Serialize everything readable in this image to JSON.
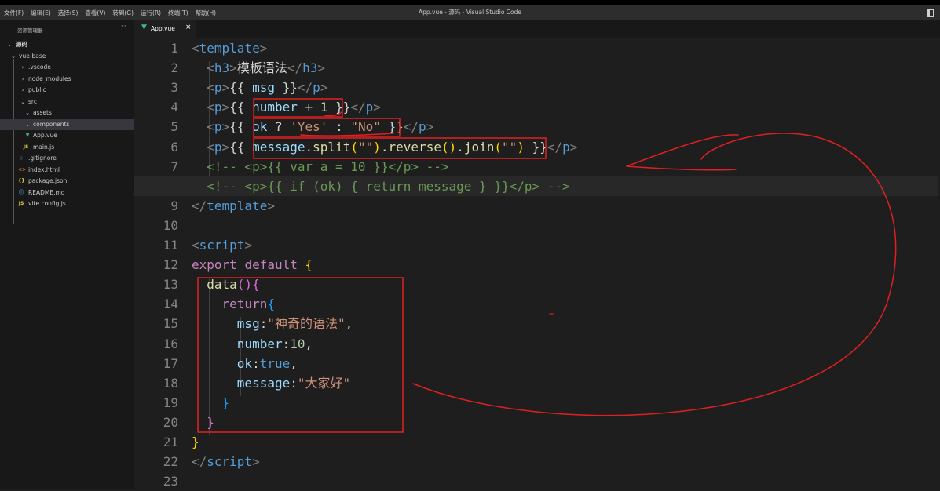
{
  "window": {
    "title": "App.vue - 源码 - Visual Studio Code"
  },
  "menu": [
    "文件(F)",
    "编辑(E)",
    "选择(S)",
    "查看(V)",
    "转到(G)",
    "运行(R)",
    "终端(T)",
    "帮助(H)"
  ],
  "sidebar": {
    "title": "资源管理器",
    "more": "···",
    "root": "源码",
    "project": "vue-base",
    "items": {
      "vscode": ".vscode",
      "node_modules": "node_modules",
      "public": "public",
      "src": "src",
      "assets": "assets",
      "components": "components",
      "app_vue": "App.vue",
      "main_js": "main.js",
      "gitignore": ".gitignore",
      "index_html": "index.html",
      "package_json": "package.json",
      "readme": "README.md",
      "vite_config": "vite.config.js"
    }
  },
  "tab": {
    "label": "App.vue",
    "close": "×"
  },
  "editor": {
    "active_line": 8,
    "line_numbers": [
      "1",
      "2",
      "3",
      "4",
      "5",
      "6",
      "7",
      "8",
      "9",
      "10",
      "11",
      "12",
      "13",
      "14",
      "15",
      "16",
      "17",
      "18",
      "19",
      "20",
      "21",
      "22",
      "23"
    ],
    "lines": [
      [
        [
          "tk-brk",
          "<"
        ],
        [
          "tk-tag",
          "template"
        ],
        [
          "tk-brk",
          ">"
        ]
      ],
      [
        [
          "tk-txt",
          "  "
        ],
        [
          "tk-brk",
          "<"
        ],
        [
          "tk-tag",
          "h3"
        ],
        [
          "tk-brk",
          ">"
        ],
        [
          "tk-txt",
          "模板语法"
        ],
        [
          "tk-brk",
          "</"
        ],
        [
          "tk-tag",
          "h3"
        ],
        [
          "tk-brk",
          ">"
        ]
      ],
      [
        [
          "tk-txt",
          "  "
        ],
        [
          "tk-brk",
          "<"
        ],
        [
          "tk-tag",
          "p"
        ],
        [
          "tk-brk",
          ">"
        ],
        [
          "tk-txt",
          "{{ "
        ],
        [
          "tk-var",
          "msg"
        ],
        [
          "tk-txt",
          " }}"
        ],
        [
          "tk-brk",
          "</"
        ],
        [
          "tk-tag",
          "p"
        ],
        [
          "tk-brk",
          ">"
        ]
      ],
      [
        [
          "tk-txt",
          "  "
        ],
        [
          "tk-brk",
          "<"
        ],
        [
          "tk-tag",
          "p"
        ],
        [
          "tk-brk",
          ">"
        ],
        [
          "tk-txt",
          "{{ "
        ],
        [
          "tk-var",
          "number"
        ],
        [
          "tk-txt",
          " + "
        ],
        [
          "tk-num",
          "1"
        ],
        [
          "tk-txt",
          " }}"
        ],
        [
          "tk-brk",
          "</"
        ],
        [
          "tk-tag",
          "p"
        ],
        [
          "tk-brk",
          ">"
        ]
      ],
      [
        [
          "tk-txt",
          "  "
        ],
        [
          "tk-brk",
          "<"
        ],
        [
          "tk-tag",
          "p"
        ],
        [
          "tk-brk",
          ">"
        ],
        [
          "tk-txt",
          "{{ "
        ],
        [
          "tk-var",
          "ok"
        ],
        [
          "tk-txt",
          " ? "
        ],
        [
          "tk-str",
          "'Yes'"
        ],
        [
          "tk-txt",
          " : "
        ],
        [
          "tk-str",
          "\"No\""
        ],
        [
          "tk-txt",
          " }}"
        ],
        [
          "tk-brk",
          "</"
        ],
        [
          "tk-tag",
          "p"
        ],
        [
          "tk-brk",
          ">"
        ]
      ],
      [
        [
          "tk-txt",
          "  "
        ],
        [
          "tk-brk",
          "<"
        ],
        [
          "tk-tag",
          "p"
        ],
        [
          "tk-brk",
          ">"
        ],
        [
          "tk-txt",
          "{{ "
        ],
        [
          "tk-var",
          "message"
        ],
        [
          "tk-txt",
          "."
        ],
        [
          "tk-fn",
          "split"
        ],
        [
          "tk-b1",
          "("
        ],
        [
          "tk-str",
          "\"\""
        ],
        [
          "tk-b1",
          ")"
        ],
        [
          "tk-txt",
          "."
        ],
        [
          "tk-fn",
          "reverse"
        ],
        [
          "tk-b1",
          "()"
        ],
        [
          "tk-txt",
          "."
        ],
        [
          "tk-fn",
          "join"
        ],
        [
          "tk-b1",
          "("
        ],
        [
          "tk-str",
          "\"\""
        ],
        [
          "tk-b1",
          ")"
        ],
        [
          "tk-txt",
          " }}"
        ],
        [
          "tk-brk",
          "</"
        ],
        [
          "tk-tag",
          "p"
        ],
        [
          "tk-brk",
          ">"
        ]
      ],
      [
        [
          "tk-cmt",
          "  <!-- <p>{{ var a = 10 }}</p> -->"
        ]
      ],
      [
        [
          "tk-cmt",
          "  <!-- <p>{{ if (ok) { return message } }}</p> -->"
        ]
      ],
      [
        [
          "tk-brk",
          "</"
        ],
        [
          "tk-tag",
          "template"
        ],
        [
          "tk-brk",
          ">"
        ]
      ],
      [],
      [
        [
          "tk-brk",
          "<"
        ],
        [
          "tk-tag",
          "script"
        ],
        [
          "tk-brk",
          ">"
        ]
      ],
      [
        [
          "tk-kw",
          "export"
        ],
        [
          "tk-txt",
          " "
        ],
        [
          "tk-kw",
          "default"
        ],
        [
          "tk-txt",
          " "
        ],
        [
          "tk-b1",
          "{"
        ]
      ],
      [
        [
          "tk-txt",
          "  "
        ],
        [
          "tk-fn",
          "data"
        ],
        [
          "tk-b2",
          "()"
        ],
        [
          "tk-b2",
          "{"
        ]
      ],
      [
        [
          "tk-txt",
          "    "
        ],
        [
          "tk-kw",
          "return"
        ],
        [
          "tk-b3",
          "{"
        ]
      ],
      [
        [
          "tk-txt",
          "      "
        ],
        [
          "tk-var",
          "msg"
        ],
        [
          "tk-txt",
          ":"
        ],
        [
          "tk-str",
          "\"神奇的语法\""
        ],
        [
          "tk-txt",
          ","
        ]
      ],
      [
        [
          "tk-txt",
          "      "
        ],
        [
          "tk-var",
          "number"
        ],
        [
          "tk-txt",
          ":"
        ],
        [
          "tk-num",
          "10"
        ],
        [
          "tk-txt",
          ","
        ]
      ],
      [
        [
          "tk-txt",
          "      "
        ],
        [
          "tk-var",
          "ok"
        ],
        [
          "tk-txt",
          ":"
        ],
        [
          "tk-kwb",
          "true"
        ],
        [
          "tk-txt",
          ","
        ]
      ],
      [
        [
          "tk-txt",
          "      "
        ],
        [
          "tk-var",
          "message"
        ],
        [
          "tk-txt",
          ":"
        ],
        [
          "tk-str",
          "\"大家好\""
        ]
      ],
      [
        [
          "tk-txt",
          "    "
        ],
        [
          "tk-b3",
          "}"
        ]
      ],
      [
        [
          "tk-txt",
          "  "
        ],
        [
          "tk-b2",
          "}"
        ]
      ],
      [
        [
          "tk-b1",
          "}"
        ]
      ],
      [
        [
          "tk-brk",
          "</"
        ],
        [
          "tk-tag",
          "script"
        ],
        [
          "tk-brk",
          ">"
        ]
      ],
      []
    ]
  },
  "colors": {
    "annotation_red": "#e02020",
    "background": "#1e1e1e",
    "sidebar_bg": "#181818",
    "menubar_bg": "#2d2d2d"
  }
}
